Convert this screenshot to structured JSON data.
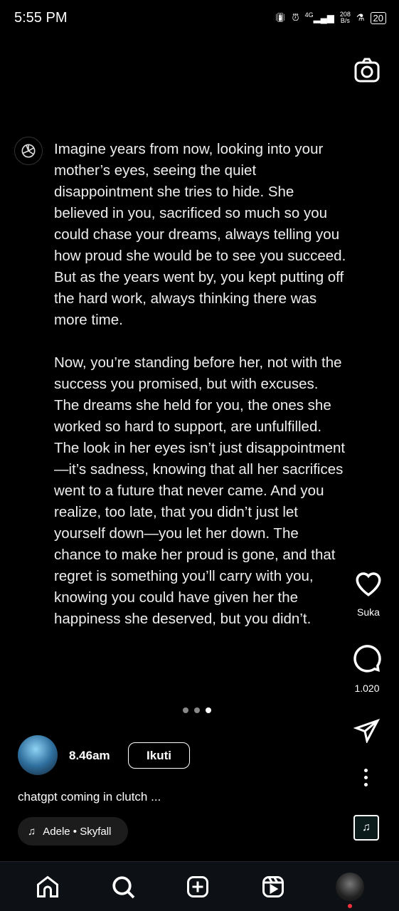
{
  "status_bar": {
    "time": "5:55 PM",
    "net_speed": "208",
    "net_unit": "B/s",
    "network": "4G",
    "battery": "20"
  },
  "post": {
    "paragraphs": [
      [
        "Imagine years from now, looking into your",
        "mother’s eyes, seeing the quiet",
        "disappointment she tries to hide. She",
        "believed in you, sacrificed so much so you",
        "could chase your dreams, always telling you",
        "how proud she would be to see you succeed.",
        "But as the years went by, you kept putting off",
        "the hard work, always thinking there was",
        "more time."
      ],
      [
        "Now, you’re standing before her, not with the",
        "success you promised, but with excuses.",
        "The dreams she held for you, the ones she",
        "worked so hard to support, are unfulfilled.",
        "The look in her eyes isn’t just disappointment",
        "—it’s sadness, knowing that all her sacrifices",
        "went to a future that never came. And you",
        "realize, too late, that you didn’t just let",
        "yourself down—you let her down. The",
        "chance to make her proud is gone, and that",
        "regret is something you’ll carry with you,",
        "knowing you could have given her the",
        "happiness she deserved, but you didn’t."
      ]
    ]
  },
  "actions": {
    "like_label": "Suka",
    "comment_count": "1.020"
  },
  "carousel": {
    "count": 3,
    "active": 3
  },
  "author": {
    "username": "8.46am",
    "follow_label": "Ikuti",
    "caption": "chatgpt coming in clutch ..."
  },
  "music": {
    "label": "Adele • Skyfall"
  }
}
